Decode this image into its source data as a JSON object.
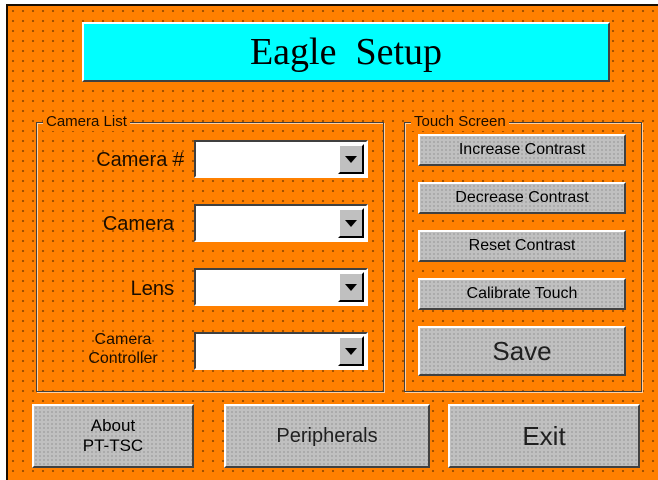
{
  "title": "Eagle  Setup",
  "camera_list": {
    "group_label": "Camera List",
    "fields": [
      {
        "label": "Camera #",
        "value": ""
      },
      {
        "label": "Camera",
        "value": ""
      },
      {
        "label": "Lens",
        "value": ""
      },
      {
        "label": "Camera\nController",
        "value": ""
      }
    ]
  },
  "touch_screen": {
    "group_label": "Touch Screen",
    "increase_label": "Increase Contrast",
    "decrease_label": "Decrease Contrast",
    "reset_label": "Reset Contrast",
    "calibrate_label": "Calibrate Touch",
    "save_label": "Save"
  },
  "footer": {
    "about_label": "About\nPT-TSC",
    "peripherals_label": "Peripherals",
    "exit_label": "Exit"
  },
  "icons": {
    "combo_arrow": "chevron-down-icon"
  },
  "colors": {
    "background": "#ff8000",
    "title_bar": "#00ffff",
    "button": "#c0c0c0"
  }
}
